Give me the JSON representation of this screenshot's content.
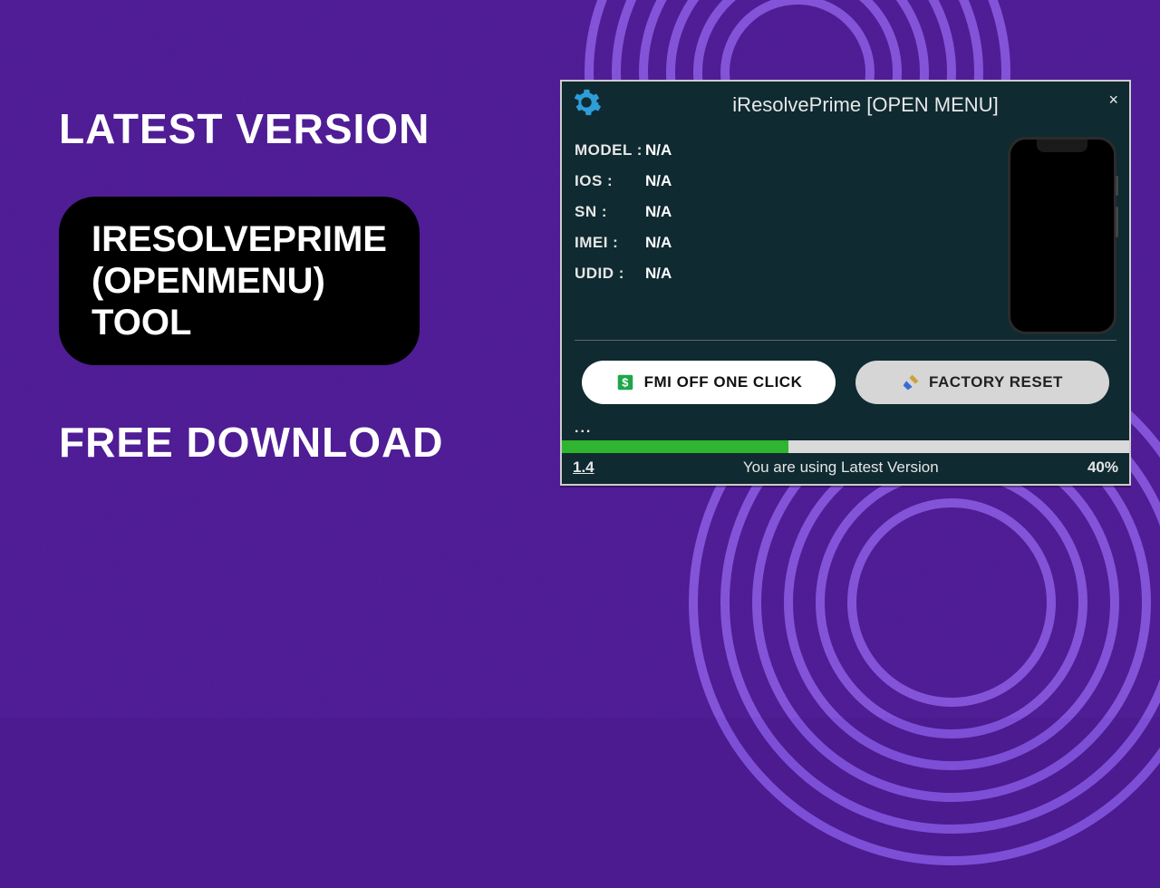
{
  "promo": {
    "header": "LATEST VERSION",
    "pill_line1": "IRESOLVEPRIME",
    "pill_line2": "(OPENMENU)",
    "pill_line3": "TOOL",
    "sub": "FREE DOWNLOAD"
  },
  "app": {
    "title": "iResolvePrime [OPEN MENU]",
    "close_symbol": "×",
    "fields": {
      "model": {
        "label": "MODEL :",
        "value": "N/A"
      },
      "ios": {
        "label": "IOS :",
        "value": "N/A"
      },
      "sn": {
        "label": "SN :",
        "value": "N/A"
      },
      "imei": {
        "label": "IMEI :",
        "value": "N/A"
      },
      "udid": {
        "label": "UDID :",
        "value": "N/A"
      }
    },
    "buttons": {
      "fmi": "FMI OFF ONE CLICK",
      "reset": "FACTORY RESET"
    },
    "ellipsis": "...",
    "progress_percent": 40,
    "status": {
      "version": "1.4",
      "message": "You are using Latest Version",
      "percent_label": "40%"
    }
  }
}
